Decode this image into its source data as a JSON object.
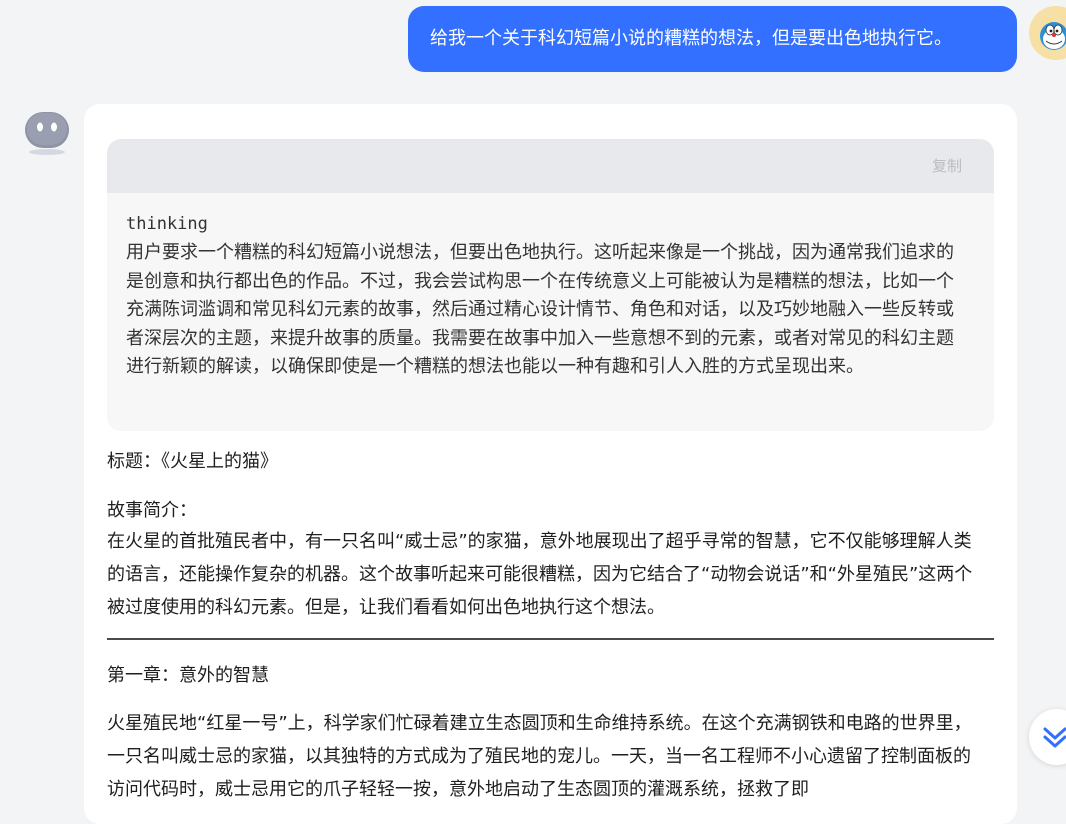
{
  "user_message": {
    "text": "给我一个关于科幻短篇小说的糟糕的想法，但是要出色地执行它。"
  },
  "icons": {
    "user_avatar": "doraemon-avatar-icon",
    "bot_avatar": "robot-face-icon",
    "scroll_down": "double-chevron-down-icon"
  },
  "colors": {
    "accent": "#3370ff",
    "background": "#f3f4f6"
  },
  "response": {
    "code_block": {
      "copy_label": "复制",
      "language": "thinking",
      "content": "用户要求一个糟糕的科幻短篇小说想法，但要出色地执行。这听起来像是一个挑战，因为通常我们追求的是创意和执行都出色的作品。不过，我会尝试构思一个在传统意义上可能被认为是糟糕的想法，比如一个充满陈词滥调和常见科幻元素的故事，然后通过精心设计情节、角色和对话，以及巧妙地融入一些反转或者深层次的主题，来提升故事的质量。我需要在故事中加入一些意想不到的元素，或者对常见的科幻主题进行新颖的解读，以确保即使是一个糟糕的想法也能以一种有趣和引人入胜的方式呈现出来。"
    },
    "title_line": "标题：《火星上的猫》",
    "synopsis_label": "故事简介：",
    "synopsis": "在火星的首批殖民者中，有一只名叫“威士忌”的家猫，意外地展现出了超乎寻常的智慧，它不仅能够理解人类的语言，还能操作复杂的机器。这个故事听起来可能很糟糕，因为它结合了“动物会说话”和“外星殖民”这两个被过度使用的科幻元素。但是，让我们看看如何出色地执行这个想法。",
    "chapter_title": "第一章：意外的智慧",
    "chapter_text": "火星殖民地“红星一号”上，科学家们忙碌着建立生态圆顶和生命维持系统。在这个充满钢铁和电路的世界里，一只名叫威士忌的家猫，以其独特的方式成为了殖民地的宠儿。一天，当一名工程师不小心遗留了控制面板的访问代码时，威士忌用它的爪子轻轻一按，意外地启动了生态圆顶的灌溉系统，拯救了即"
  }
}
